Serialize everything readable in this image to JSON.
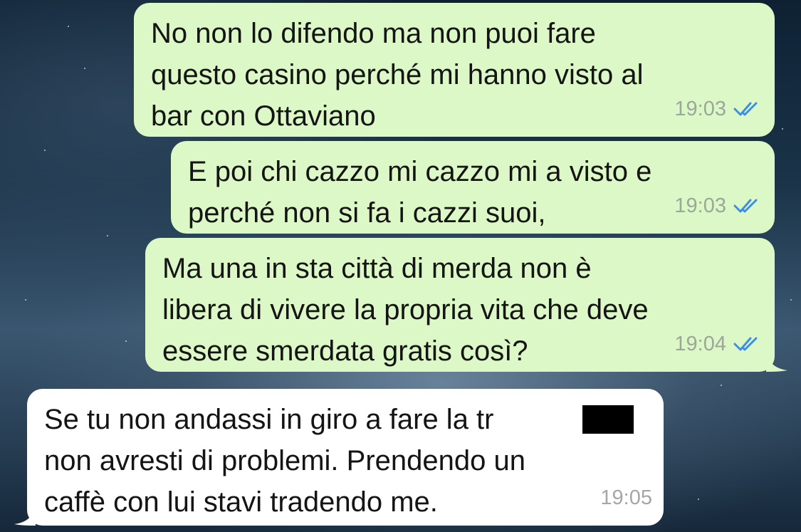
{
  "messages": [
    {
      "direction": "outgoing",
      "text": "No non lo difendo ma non puoi fare\nquesto casino perché mi hanno visto al\nbar con Ottaviano",
      "time": "19:03",
      "status": "read"
    },
    {
      "direction": "outgoing",
      "text": "E poi chi cazzo mi cazzo mi a visto e\nperché non si fa i cazzi suoi,",
      "time": "19:03",
      "status": "read"
    },
    {
      "direction": "outgoing",
      "text": "Ma una in sta città di merda non è\nlibera di vivere la propria vita che deve\nessere smerdata gratis così?",
      "time": "19:04",
      "status": "read"
    },
    {
      "direction": "incoming",
      "text": "Se tu non andassi in giro a fare la tr\nnon avresti di problemi. Prendendo un\ncaffè con lui stavi tradendo me.",
      "time": "19:05",
      "status": ""
    }
  ],
  "colors": {
    "outgoing_bubble": "#dcf8c6",
    "incoming_bubble": "#ffffff",
    "read_ticks": "#3d8ee6",
    "timestamp": "#9aa79a",
    "redaction": "#000000"
  },
  "icons": {
    "read_receipt": "double-check-icon",
    "bubble_tail": "bubble-tail"
  }
}
